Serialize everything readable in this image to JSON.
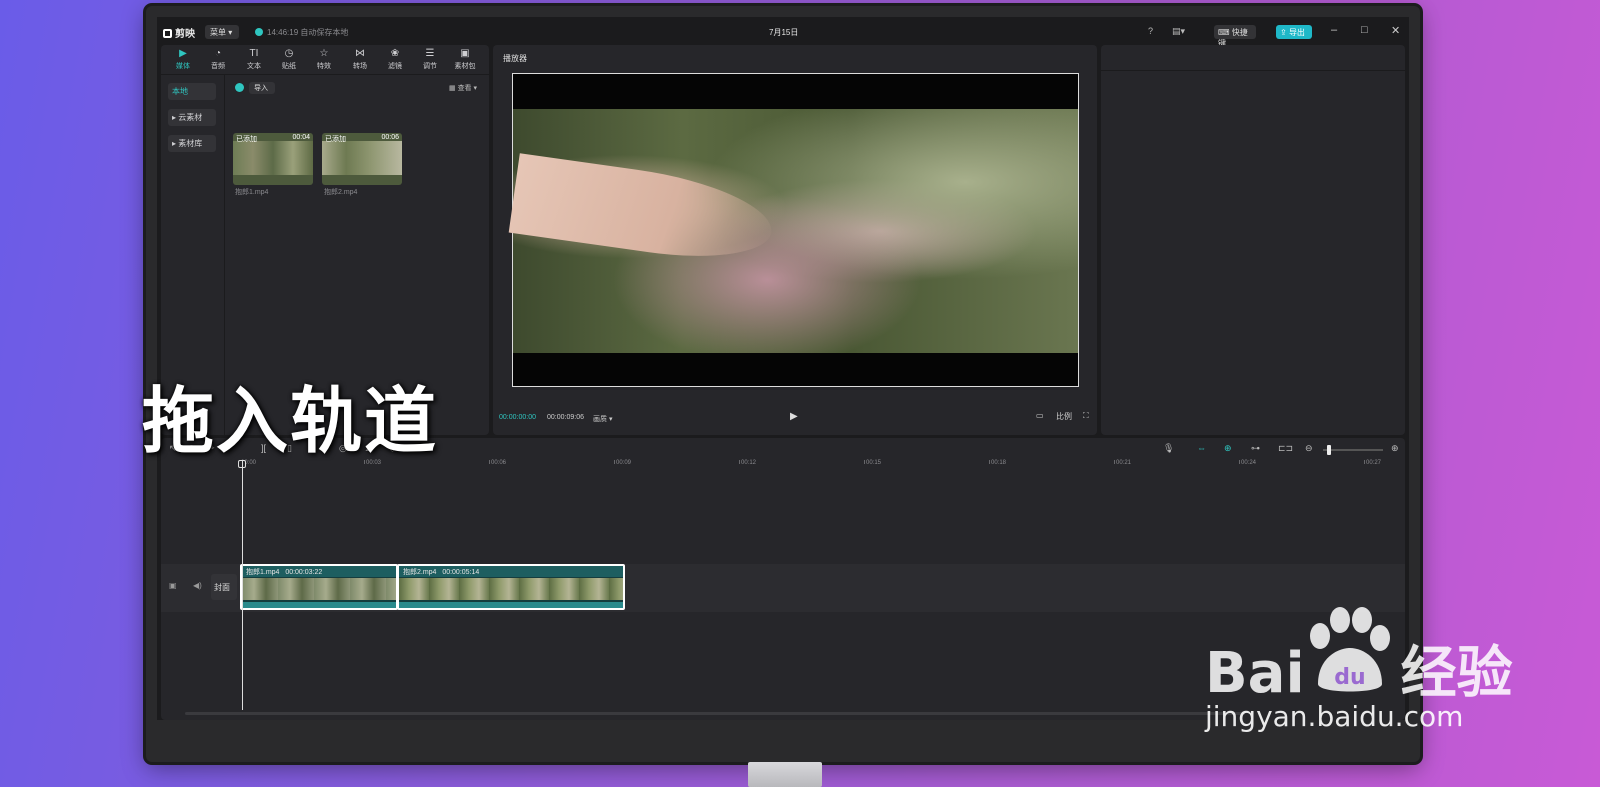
{
  "app": {
    "name": "剪映",
    "menu_label": "菜单",
    "autosave_text": "14:46:19 自动保存本地",
    "project_title": "7月15日",
    "shortcut_label": "快捷键",
    "export_label": "导出"
  },
  "media_tabs": [
    {
      "label": "媒体",
      "icon": "media-icon"
    },
    {
      "label": "音频",
      "icon": "audio-icon"
    },
    {
      "label": "文本",
      "icon": "text-icon"
    },
    {
      "label": "贴纸",
      "icon": "sticker-icon"
    },
    {
      "label": "特效",
      "icon": "effects-icon"
    },
    {
      "label": "转场",
      "icon": "transition-icon"
    },
    {
      "label": "滤镜",
      "icon": "filter-icon"
    },
    {
      "label": "调节",
      "icon": "adjust-icon"
    },
    {
      "label": "素材包",
      "icon": "package-icon"
    }
  ],
  "media_side": {
    "local": "本地",
    "cloud": "云素材",
    "library": "素材库"
  },
  "media_toolbar": {
    "import_label": "导入",
    "sort_label": "查看"
  },
  "media_items": [
    {
      "badge": "已添加",
      "duration": "00:04",
      "name": "抱郎1.mp4"
    },
    {
      "badge": "已添加",
      "duration": "00:06",
      "name": "抱郎2.mp4"
    }
  ],
  "player": {
    "title": "播放器",
    "current_time": "00:00:00:00",
    "total_time": "00:00:09:06",
    "quality_label": "画质",
    "ratio_label": "比例"
  },
  "timeline": {
    "ruler_ticks": [
      "00:00",
      "00:03",
      "00:06",
      "00:09",
      "00:12",
      "00:15",
      "00:18",
      "00:21",
      "00:24",
      "00:27"
    ],
    "cover_label": "封面",
    "clips": [
      {
        "name": "抱郎1.mp4",
        "duration": "00:00:03:22"
      },
      {
        "name": "抱郎2.mp4",
        "duration": "00:00:05:14"
      }
    ]
  },
  "overlay": {
    "caption": "拖入轨道",
    "watermark_brand": "Bai",
    "watermark_brand2": "经验",
    "watermark_url": "jingyan.baidu.com"
  },
  "colors": {
    "accent": "#2fc6c0",
    "clip_header": "#1d5e60"
  }
}
